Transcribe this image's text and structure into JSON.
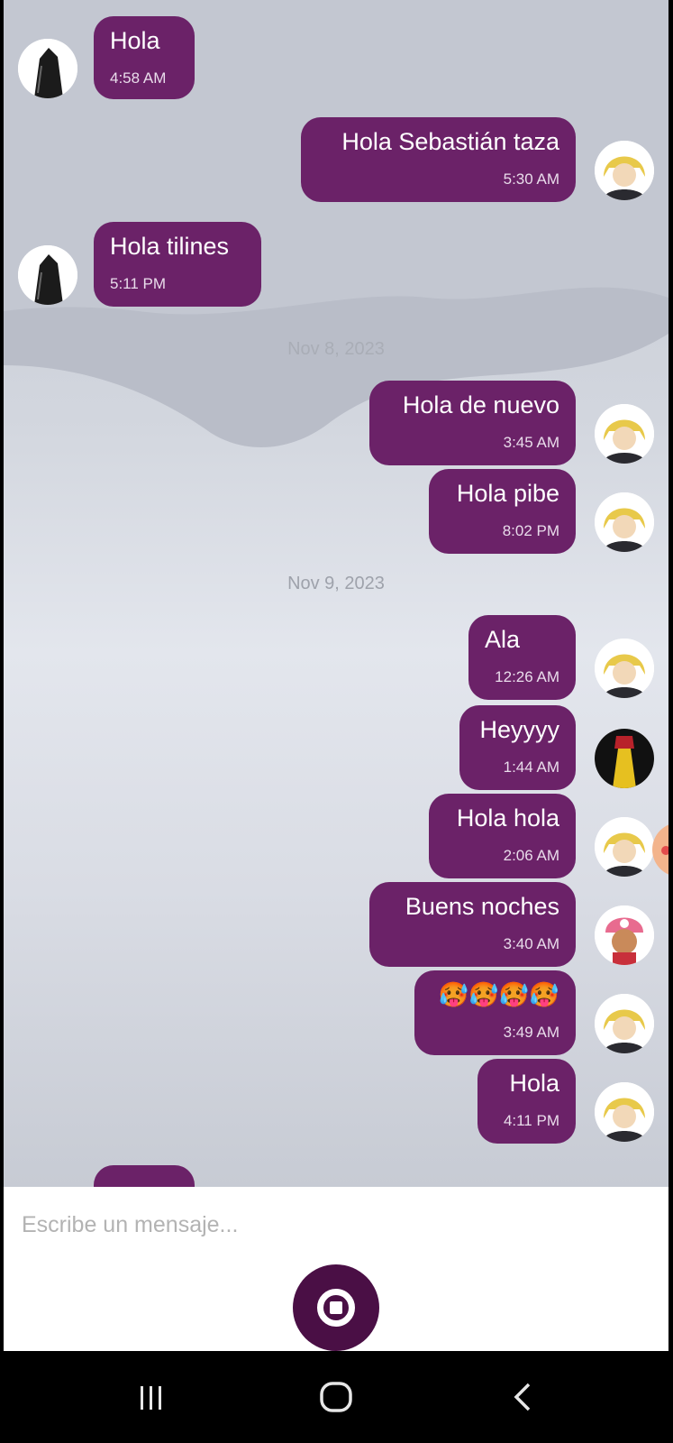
{
  "messages": [
    {
      "text": "Hola",
      "time": "4:58 AM",
      "direction": "in",
      "avatar": "dark-cloaked-figure"
    },
    {
      "text": "Hola Sebastián taza",
      "time": "5:30 AM",
      "direction": "out",
      "avatar": "blonde-anime-character"
    },
    {
      "text": "Hola tilines",
      "time": "5:11 PM",
      "direction": "in",
      "avatar": "dark-cloaked-figure"
    },
    {
      "text": "Hola de nuevo",
      "time": "3:45 AM",
      "direction": "out",
      "avatar": "blonde-anime-character"
    },
    {
      "text": "Hola pibe",
      "time": "8:02 PM",
      "direction": "out",
      "avatar": "blonde-anime-character"
    },
    {
      "text": "Ala",
      "time": "12:26 AM",
      "direction": "out",
      "avatar": "blonde-anime-character"
    },
    {
      "text": "Heyyyy",
      "time": "1:44 AM",
      "direction": "out",
      "avatar": "red-yellow-anime-character"
    },
    {
      "text": "Hola hola",
      "time": "2:06 AM",
      "direction": "out",
      "avatar": "blonde-anime-character"
    },
    {
      "text": "Buens noches",
      "time": "3:40 AM",
      "direction": "out",
      "avatar": "pink-hat-reindeer-character"
    },
    {
      "text": "🥵🥵🥵🥵",
      "time": "3:49 AM",
      "direction": "out",
      "avatar": "blonde-anime-character"
    },
    {
      "text": "Hola",
      "time": "4:11 PM",
      "direction": "out",
      "avatar": "blonde-anime-character"
    }
  ],
  "date_separators": [
    "Nov 8, 2023",
    "Nov 9, 2023"
  ],
  "composer": {
    "placeholder": "Escribe un mensaje...",
    "send_icon": "record-stop-icon"
  },
  "nav": {
    "recent_icon": "recent-apps-icon",
    "home_icon": "home-icon",
    "back_icon": "back-icon"
  },
  "colors": {
    "bubble": "#6b2268",
    "send_button": "#4a0f45"
  }
}
